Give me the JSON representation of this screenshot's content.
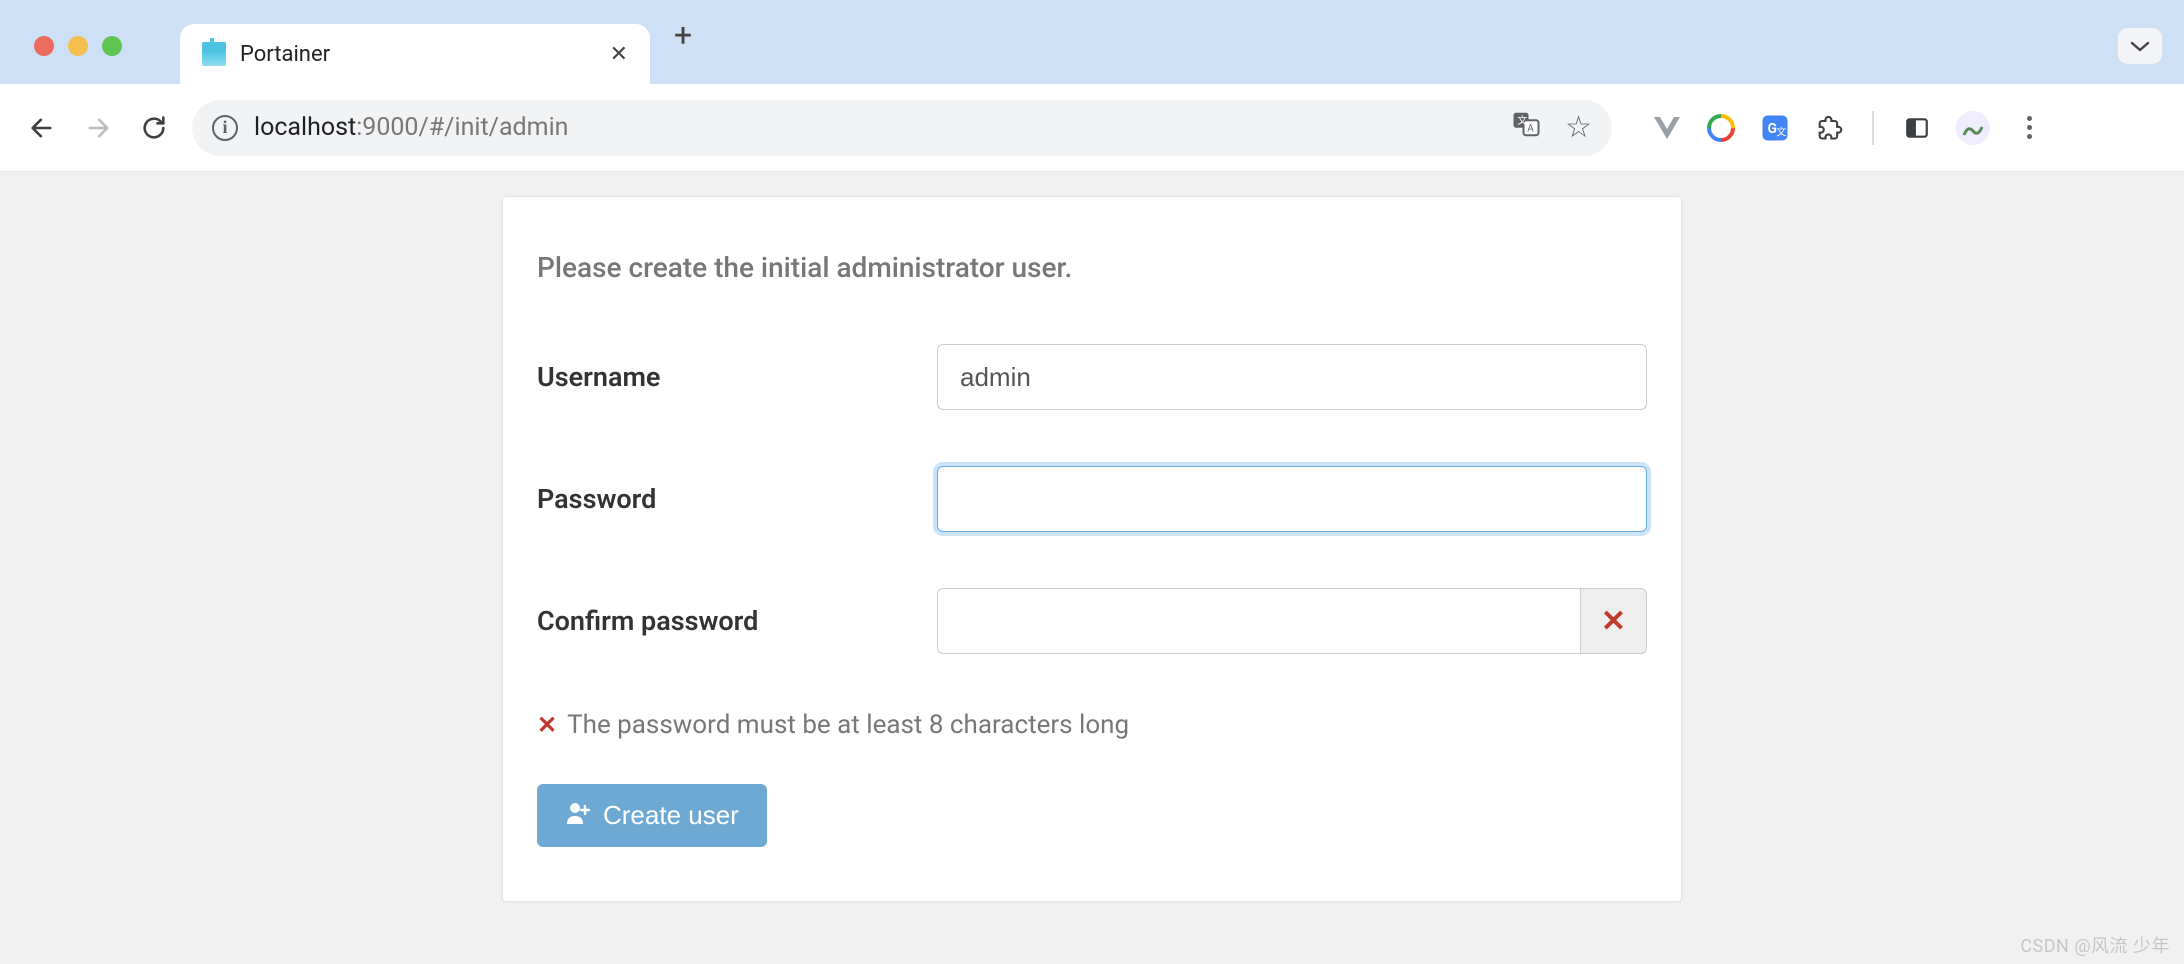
{
  "browser": {
    "tab_title": "Portainer",
    "url_host": "localhost",
    "url_path": ":9000/#/init/admin"
  },
  "page": {
    "heading": "Please create the initial administrator user.",
    "labels": {
      "username": "Username",
      "password": "Password",
      "confirm_password": "Confirm password"
    },
    "values": {
      "username": "admin",
      "password": "",
      "confirm_password": ""
    },
    "validation_message": "The password must be at least 8 characters long",
    "submit_label": "Create user",
    "addon_icon": "✕",
    "validation_icon": "✕"
  },
  "watermark": "CSDN @风流 少年"
}
